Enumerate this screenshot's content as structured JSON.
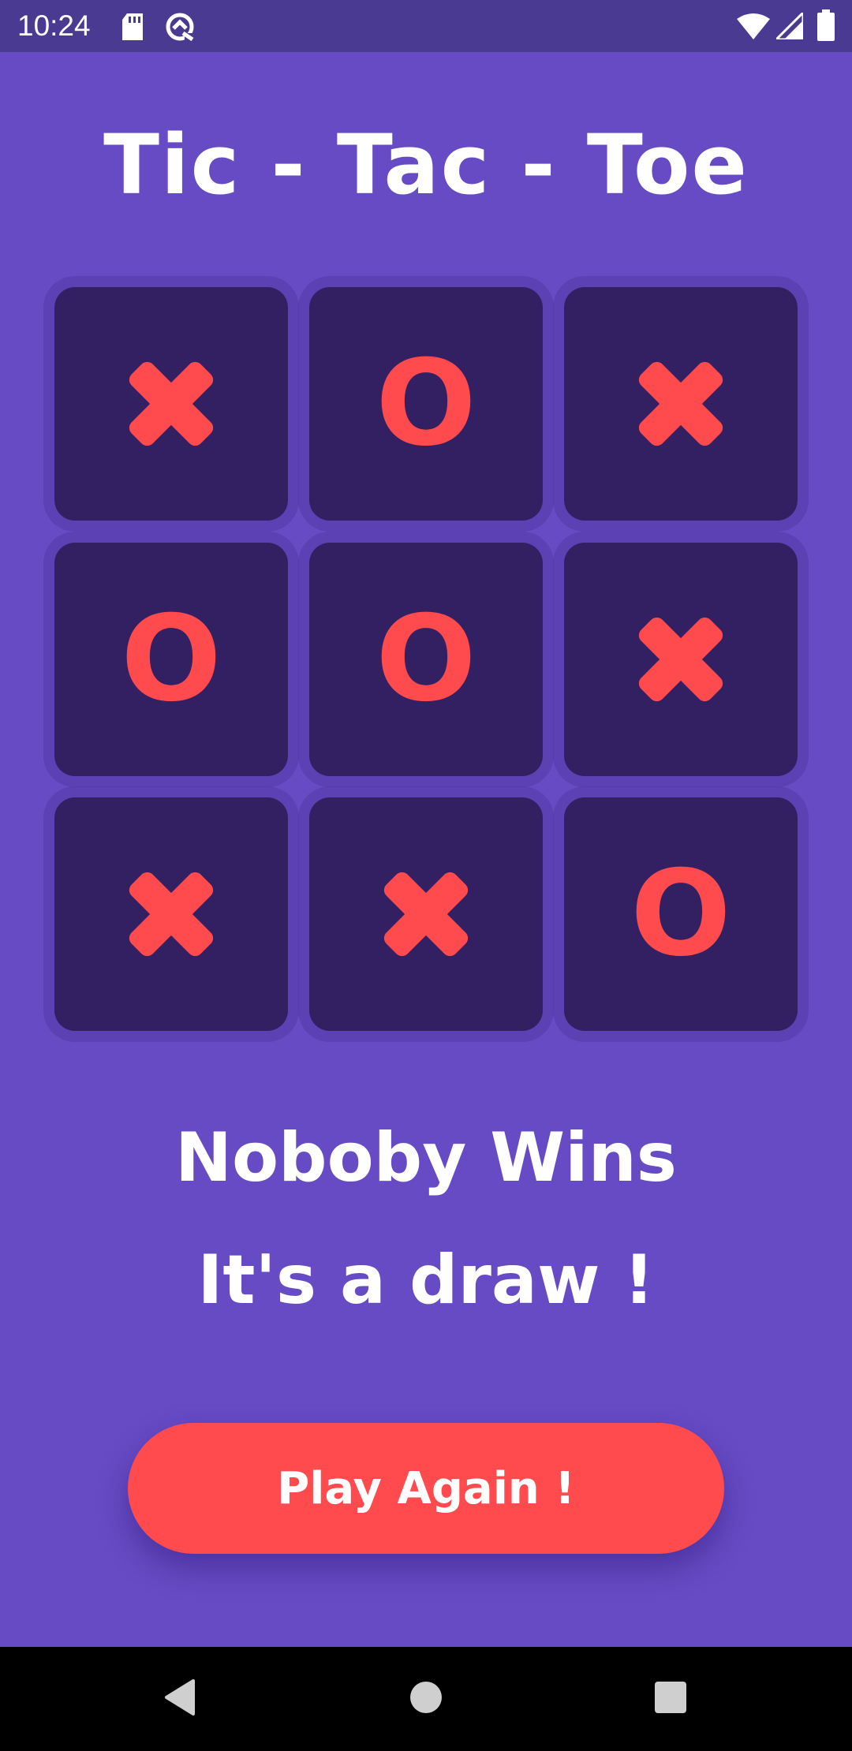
{
  "status_bar": {
    "time": "10:24",
    "icons": [
      "sd-card-icon",
      "sync-icon",
      "wifi-icon",
      "signal-icon",
      "battery-icon"
    ]
  },
  "app": {
    "title": "Tic - Tac - Toe",
    "board": {
      "cells": [
        "X",
        "O",
        "X",
        "O",
        "O",
        "X",
        "X",
        "X",
        "O"
      ]
    },
    "result": {
      "line1": "Noboby Wins",
      "line2": "It's a draw !"
    },
    "play_again_label": "Play Again !"
  },
  "navigation_bar": {
    "buttons": [
      "back-icon",
      "home-icon",
      "recents-icon"
    ]
  },
  "colors": {
    "background": "#674bc5",
    "status_bar": "#4a3a92",
    "cell": "#322062",
    "mark": "#ff4b4e",
    "button": "#ff4b4e",
    "text": "#ffffff"
  }
}
